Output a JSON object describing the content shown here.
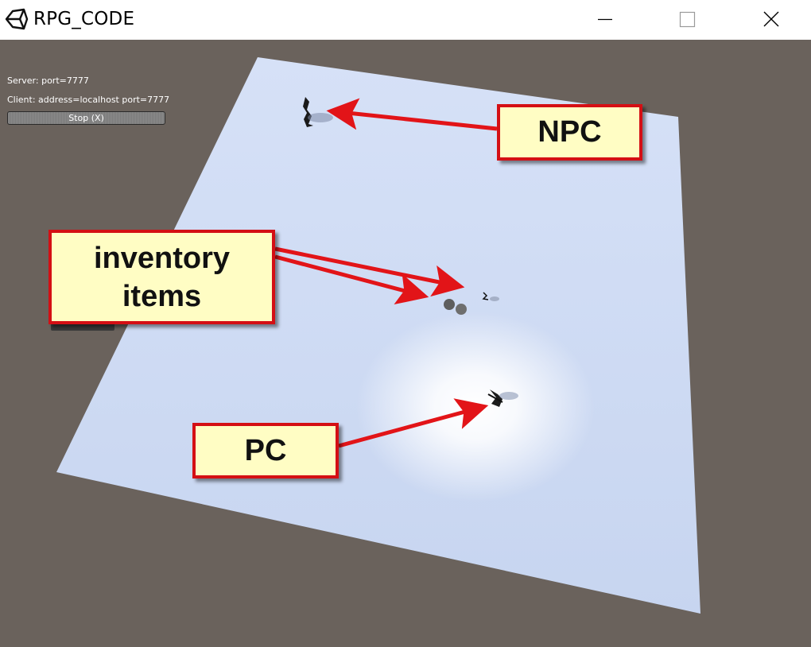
{
  "window": {
    "title": "RPG_CODE",
    "app_icon": "unity-logo-icon",
    "controls": {
      "minimize_icon": "minimize-icon",
      "maximize_icon": "maximize-icon",
      "close_icon": "close-icon"
    }
  },
  "hud": {
    "server_text": "Server: port=7777",
    "client_text": "Client: address=localhost port=7777",
    "stop_button_label": "Stop (X)"
  },
  "annotations": {
    "npc_label": "NPC",
    "inventory_label": "inventory items",
    "pc_label": "PC"
  },
  "colors": {
    "background": "#6a625c",
    "ground": "#cdd9f2",
    "callout_fill": "#fffdc4",
    "callout_border": "#d40f14",
    "arrow": "#e21418"
  }
}
